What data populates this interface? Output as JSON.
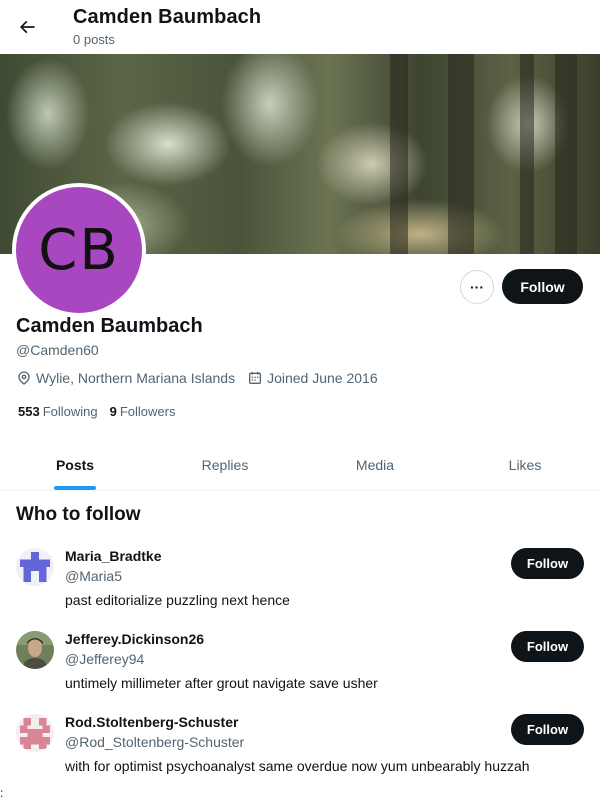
{
  "header": {
    "title": "Camden Baumbach",
    "posts_count": "0 posts"
  },
  "profile": {
    "avatar_initials": "CB",
    "avatar_color": "#a947c1",
    "display_name": "Camden Baumbach",
    "handle": "@Camden60",
    "location": "Wylie, Northern Mariana Islands",
    "joined": "Joined June 2016",
    "following_count": "553",
    "following_label": "Following",
    "followers_count": "9",
    "followers_label": "Followers",
    "more_label": "···",
    "follow_label": "Follow"
  },
  "tabs": [
    {
      "label": "Posts",
      "active": true
    },
    {
      "label": "Replies",
      "active": false
    },
    {
      "label": "Media",
      "active": false
    },
    {
      "label": "Likes",
      "active": false
    }
  ],
  "who_to_follow": {
    "title": "Who to follow",
    "users": [
      {
        "name": "Maria_Bradtke",
        "handle": "@Maria5",
        "bio": "past editorialize puzzling next hence",
        "follow_label": "Follow",
        "avatar": "identicon-blue"
      },
      {
        "name": "Jefferey.Dickinson26",
        "handle": "@Jefferey94",
        "bio": "untimely millimeter after grout navigate save usher",
        "follow_label": "Follow",
        "avatar": "photo"
      },
      {
        "name": "Rod.Stoltenberg-Schuster",
        "handle": "@Rod_Stoltenberg-Schuster",
        "bio": "with for optimist psychoanalyst same overdue now yum unbearably huzzah",
        "follow_label": "Follow",
        "avatar": "identicon-pink"
      }
    ]
  },
  "stray_char": ":",
  "colors": {
    "accent": "#1d9bf0",
    "button": "#0f1419",
    "muted": "#536471"
  }
}
